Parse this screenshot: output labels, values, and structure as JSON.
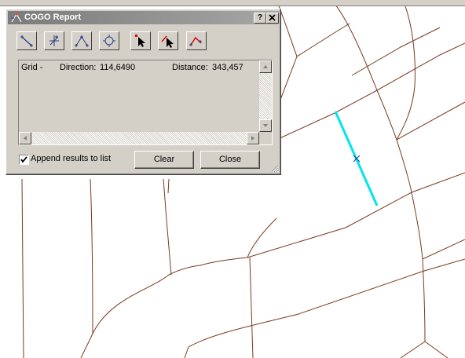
{
  "map": {
    "parcel_line_color": "#7a3a1e",
    "selected_line_color": "#00e5ee",
    "cursor_icon": "crosshair-x-icon"
  },
  "dialog": {
    "title": "COGO Report",
    "title_icon": "cogo-report-icon",
    "help_label": "?",
    "close_icon": "close-x-icon",
    "tools": [
      {
        "name": "line-tool-icon"
      },
      {
        "name": "point-add-tool-icon"
      },
      {
        "name": "angle-tool-icon"
      },
      {
        "name": "curve-tool-icon"
      },
      {
        "name": "select-pointer-icon"
      },
      {
        "name": "select-line-pointer-icon"
      },
      {
        "name": "traverse-tool-icon"
      }
    ],
    "results": [
      {
        "grid": "Grid -",
        "direction_label": "Direction:",
        "direction": "114,6490",
        "distance_label": "Distance:",
        "distance": "343,457"
      }
    ],
    "append_label": "Append results to list",
    "append_checked": true,
    "clear_label": "Clear",
    "close_label": "Close"
  }
}
